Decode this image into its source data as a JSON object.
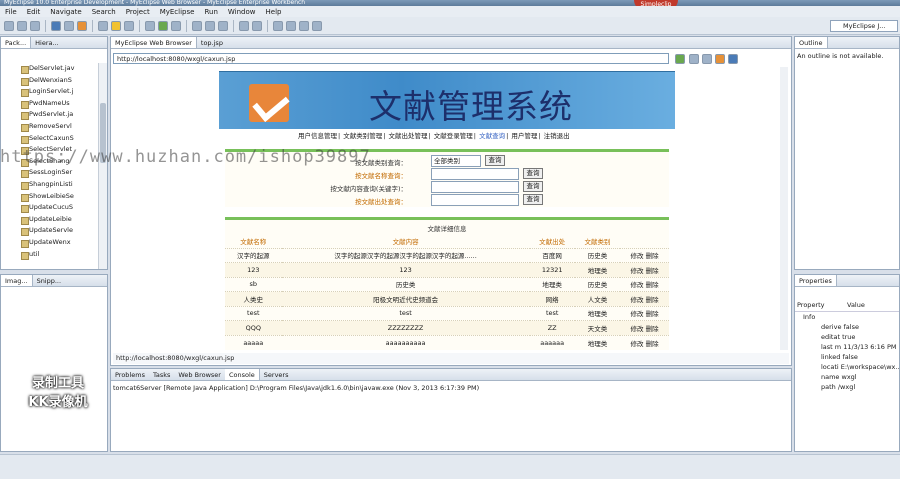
{
  "window": {
    "title": "MyEclipse 10.0 Enterprise Development - MyEclipse Web Browser - MyEclipse Enterprise Workbench"
  },
  "brand": "Simpleclip",
  "menu": [
    "File",
    "Edit",
    "Navigate",
    "Search",
    "Project",
    "MyEclipse",
    "Run",
    "Window",
    "Help"
  ],
  "perspective": "MyEclipse J...",
  "left_panel": {
    "tabs": [
      "Pack...",
      "Hiera..."
    ],
    "tree_items": [
      "DelServlet.jav",
      "DelWenxianS",
      "LoginServlet.j",
      "PwdNameUs",
      "PwdServlet.ja",
      "RemoveServl",
      "SelectCaxunS",
      "SelectServlet",
      "SelectShang",
      "SessLoginSer",
      "ShangpinListi",
      "ShowLeibieSe",
      "UpdateCucuS",
      "UpdateLeibie",
      "UpdateServle",
      "UpdateWenx",
      "util"
    ]
  },
  "image_panel": {
    "tabs": [
      "Imag...",
      "Snipp..."
    ]
  },
  "editor": {
    "tabs": [
      "MyEclipse Web Browser",
      "top.jsp"
    ],
    "url": "http://localhost:8080/wxgl/caxun.jsp",
    "status_url": "http://localhost:8080/wxgl/caxun.jsp"
  },
  "page": {
    "banner_title": "文献管理系统",
    "nav": [
      "用户信息管理",
      "文献类别管理",
      "文献出处管理",
      "文献登录管理",
      "文献查询",
      "用户管理",
      "注销退出"
    ],
    "nav_highlight_index": 4,
    "search": {
      "rows": [
        {
          "label": "按文献类别查询：",
          "select": "全部类别",
          "button": "查询"
        },
        {
          "label": "按文献名称查询：",
          "button": "查询"
        },
        {
          "label": "按文献内容查询(关键字)：",
          "button": "查询"
        },
        {
          "label": "按文献出处查询：",
          "button": "查询"
        }
      ]
    },
    "results": {
      "title": "文献详细信息",
      "headers": [
        "文献名称",
        "文献内容",
        "文献出处",
        "文献类别",
        ""
      ],
      "rows": [
        [
          "汉字的起源",
          "汉字的起源汉字的起源汉字的起源汉字的起源......",
          "百度网",
          "历史类",
          "修改 删除"
        ],
        [
          "123",
          "123",
          "12321",
          "地理类",
          "修改 删除"
        ],
        [
          "sb",
          "历史类",
          "地理类",
          "历史类",
          "修改 删除"
        ],
        [
          "人类史",
          "阳极文明近代史频道会",
          "网络",
          "人文类",
          "修改 删除"
        ],
        [
          "test",
          "test",
          "test",
          "地理类",
          "修改 删除"
        ],
        [
          "QQQ",
          "ZZZZZZZZ",
          "ZZ",
          "天文类",
          "修改 删除"
        ],
        [
          "aaaaa",
          "aaaaaaaaaa",
          "aaaaaa",
          "地理类",
          "修改 删除"
        ]
      ]
    }
  },
  "watermark": "https://www.huzhan.com/ishop39897",
  "recorder": [
    "录制工具",
    "KK录像机"
  ],
  "outline": {
    "tab": "Outline",
    "message": "An outline is not available."
  },
  "properties": {
    "tab": "Properties",
    "headers": [
      "Property",
      "Value"
    ],
    "group": "Info",
    "rows": [
      "derive false",
      "editat true",
      "last m 11/3/13 6:16 PM",
      "linked false",
      "locati E:\\workspace\\wx...",
      "name wxgl",
      "path /wxgl"
    ]
  },
  "bottom": {
    "tabs": [
      "Problems",
      "Tasks",
      "Web Browser",
      "Console",
      "Servers"
    ],
    "console_line": "tomcat6Server [Remote Java Application] D:\\Program Files\\Java\\jdk1.6.0\\bin\\javaw.exe (Nov 3, 2013 6:17:39 PM)"
  }
}
